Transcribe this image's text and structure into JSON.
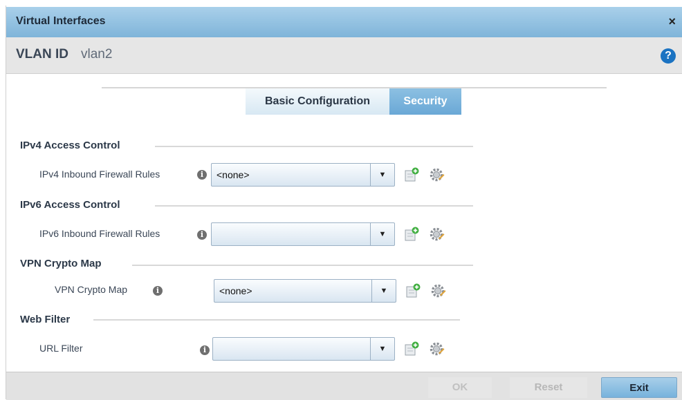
{
  "dialog": {
    "title": "Virtual Interfaces",
    "close_glyph": "×",
    "vlan_label": "VLAN ID",
    "vlan_value": "vlan2",
    "help_glyph": "?"
  },
  "tabs": [
    {
      "label": "Basic Configuration",
      "active": false
    },
    {
      "label": "Security",
      "active": true
    }
  ],
  "sections": {
    "ipv4": {
      "title": "IPv4 Access Control",
      "field_label": "IPv4 Inbound Firewall Rules",
      "value": "<none>"
    },
    "ipv6": {
      "title": "IPv6 Access Control",
      "field_label": "IPv6 Inbound Firewall Rules",
      "value": ""
    },
    "vpn": {
      "title": "VPN Crypto Map",
      "field_label": "VPN Crypto Map",
      "value": "<none>"
    },
    "web": {
      "title": "Web Filter",
      "field_label": "URL Filter",
      "value": ""
    }
  },
  "icons": {
    "info": "i",
    "dropdown": "▼",
    "add": "add-policy-icon",
    "edit": "edit-policy-gear-icon"
  },
  "buttons": {
    "ok": "OK",
    "reset": "Reset",
    "exit": "Exit"
  },
  "colors": {
    "titlebar": "#7fb4d9",
    "active_tab": "#6aa8d6",
    "help_icon": "#1b73c2",
    "add_badge": "#3fae3f"
  }
}
